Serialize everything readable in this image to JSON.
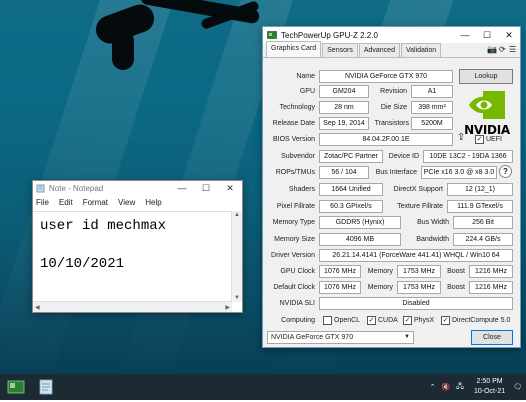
{
  "colors": {
    "desktop": "#0c6681",
    "taskbar": "#1b2a33",
    "nvidia_green": "#76b900"
  },
  "notepad": {
    "title": "Note - Notepad",
    "controls": [
      "—",
      "☐",
      "✕"
    ],
    "menu": [
      "File",
      "Edit",
      "Format",
      "View",
      "Help"
    ],
    "lines": [
      "user id mechmax",
      "",
      "10/10/2021"
    ]
  },
  "gpuz": {
    "title": "TechPowerUp GPU-Z 2.2.0",
    "controls": [
      "—",
      "☐",
      "✕"
    ],
    "tabs": [
      "Graphics Card",
      "Sensors",
      "Advanced",
      "Validation"
    ],
    "name_label": "Name",
    "name": "NVIDIA GeForce GTX 970",
    "lookup": "Lookup",
    "gpu_label": "GPU",
    "gpu": "GM204",
    "revision_label": "Revision",
    "revision": "A1",
    "technology_label": "Technology",
    "technology": "28 nm",
    "diesize_label": "Die Size",
    "diesize": "398 mm²",
    "release_label": "Release Date",
    "release": "Sep 19, 2014",
    "transistors_label": "Transistors",
    "transistors": "5200M",
    "bios_label": "BIOS Version",
    "bios": "84.04.2F.00.1E",
    "uefi": "UEFI",
    "subvendor_label": "Subvendor",
    "subvendor": "Zotac/PC Partner",
    "deviceid_label": "Device ID",
    "deviceid": "10DE 13C2 - 19DA 1366",
    "rops_label": "ROPs/TMUs",
    "rops": "56 / 104",
    "businterface_label": "Bus Interface",
    "businterface": "PCIe x16 3.0 @ x8 3.0",
    "shaders_label": "Shaders",
    "shaders": "1664 Unified",
    "directx_label": "DirectX Support",
    "directx": "12 (12_1)",
    "pixelfill_label": "Pixel Fillrate",
    "pixelfill": "60.3 GPixel/s",
    "texturefill_label": "Texture Fillrate",
    "texturefill": "111.9 GTexel/s",
    "memtype_label": "Memory Type",
    "memtype": "GDDR5 (Hynix)",
    "buswidth_label": "Bus Width",
    "buswidth": "256 Bit",
    "memsize_label": "Memory Size",
    "memsize": "4096 MB",
    "bandwidth_label": "Bandwidth",
    "bandwidth": "224.4 GB/s",
    "driver_label": "Driver Version",
    "driver": "26.21.14.4141 (ForceWare 441.41) WHQL / Win10 64",
    "gpuclock_label": "GPU Clock",
    "gpuclock": "1076 MHz",
    "memory_label": "Memory",
    "gpuclock_mem": "1753 MHz",
    "boost_label": "Boost",
    "gpuclock_boost": "1216 MHz",
    "defclock_label": "Default Clock",
    "defclock": "1076 MHz",
    "defclock_mem": "1753 MHz",
    "defclock_boost": "1216 MHz",
    "sli_label": "NVIDIA SLI",
    "sli": "Disabled",
    "computing_label": "Computing",
    "computing": [
      "OpenCL",
      "CUDA",
      "PhysX",
      "DirectCompute 5.0"
    ],
    "computing_checked": [
      false,
      true,
      true,
      true
    ],
    "logo_text": "NVIDIA",
    "selected_card": "NVIDIA GeForce GTX 970",
    "close": "Close"
  },
  "taskbar": {
    "time": "2:50 PM",
    "date": "10-Oct-21",
    "tray_icons": [
      "chevron-up-icon",
      "volume-muted-icon",
      "network-icon",
      "notification-icon"
    ]
  }
}
